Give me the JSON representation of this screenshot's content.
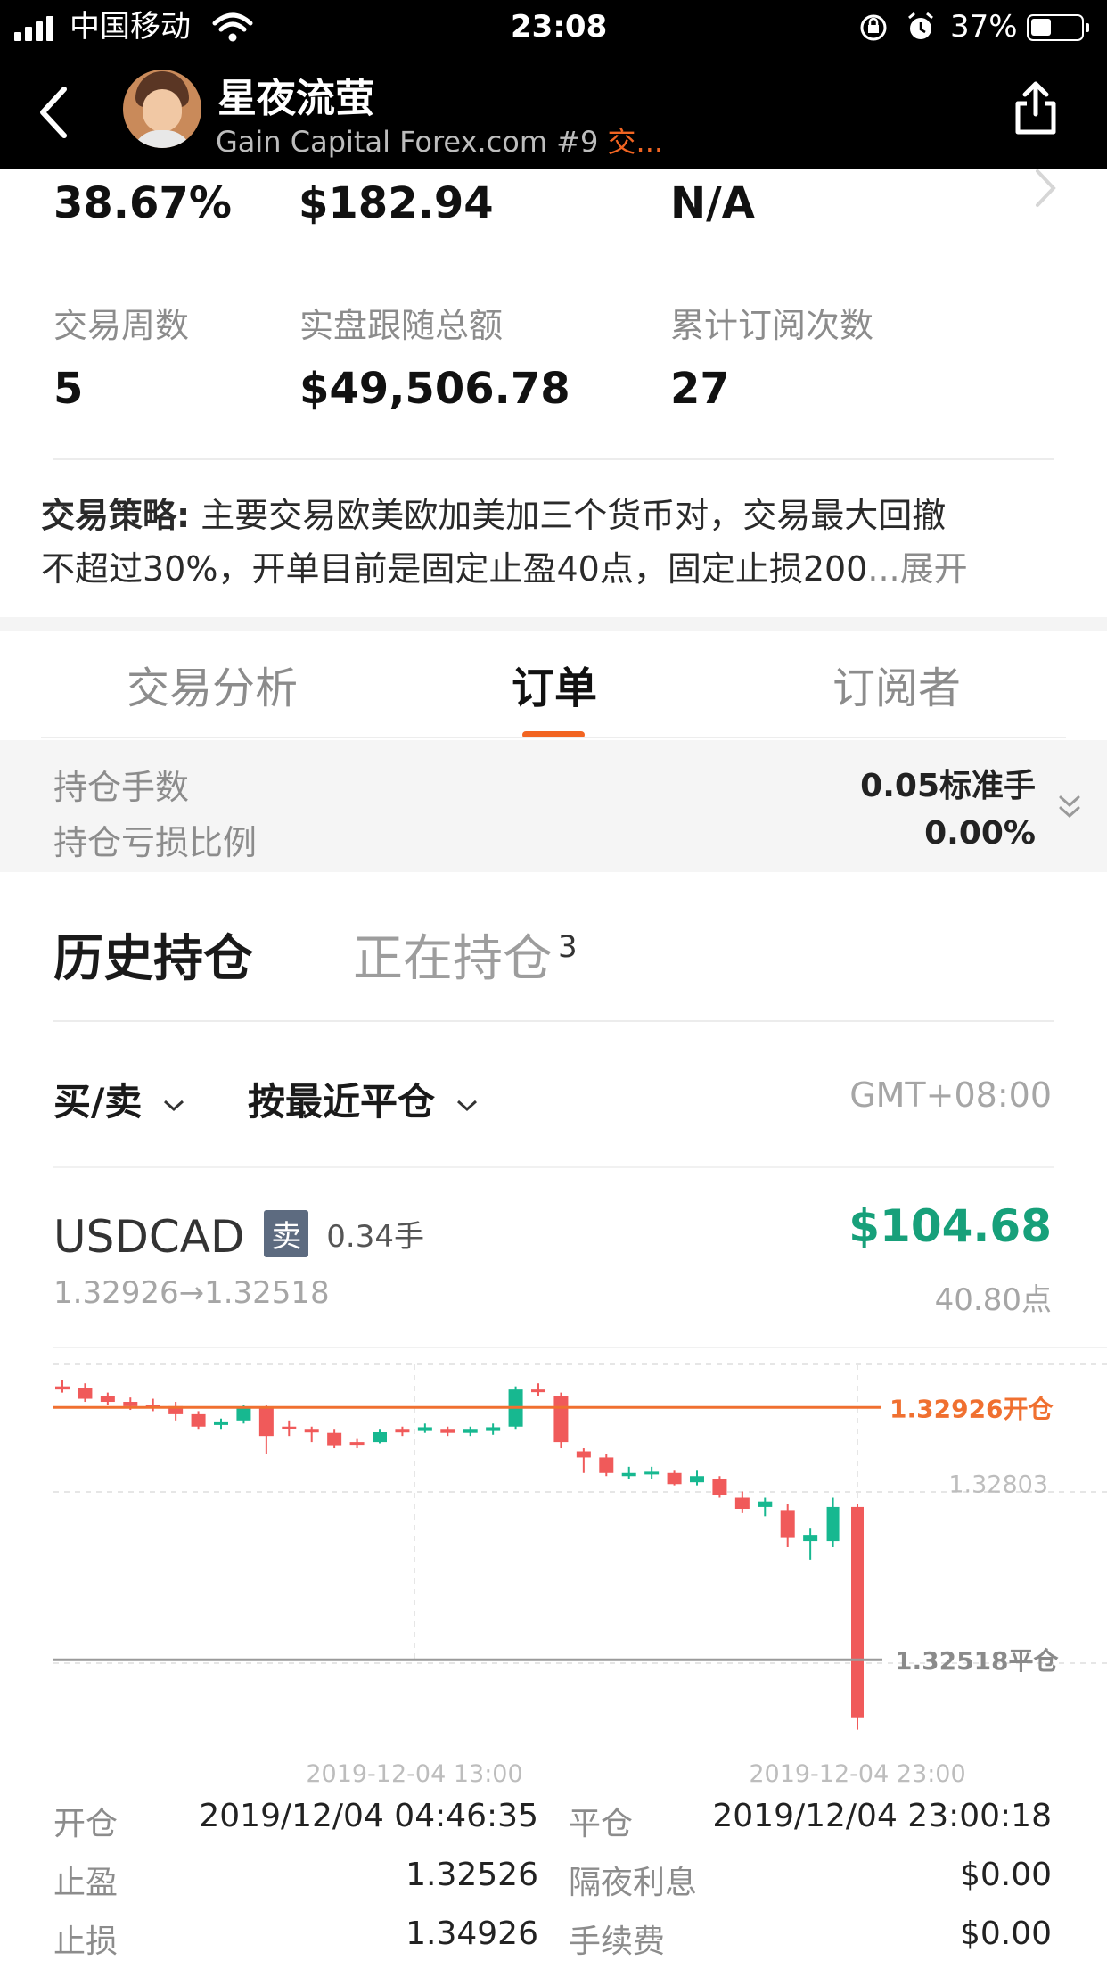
{
  "status_bar": {
    "carrier": "中国移动",
    "time": "23:08",
    "battery": "37%"
  },
  "header": {
    "name": "星夜流萤",
    "subtitle": "Gain Capital Forex.com #9",
    "subtitle_tag": "交..."
  },
  "stats_top": [
    "38.67%",
    "$182.94",
    "N/A"
  ],
  "stats_row2": {
    "labels": [
      "交易周数",
      "实盘跟随总额",
      "累计订阅次数"
    ],
    "values": [
      "5",
      "$49,506.78",
      "27"
    ]
  },
  "strategy": {
    "label": "交易策略:",
    "line1": "主要交易欧美欧加美加三个货币对，交易最大回撤",
    "line2": "不超过30%，开单目前是固定止盈40点，固定止损200",
    "ellipsis": "...",
    "expand": "展开"
  },
  "tabs": [
    "交易分析",
    "订单",
    "订阅者"
  ],
  "position_summary": {
    "lots_label": "持仓手数",
    "lots_value": "0.05标准手",
    "loss_label": "持仓亏损比例",
    "loss_value": "0.00%"
  },
  "subtabs": {
    "history": "历史持仓",
    "open": "正在持仓",
    "open_count": "3"
  },
  "filters": {
    "side": "买/卖",
    "sort": "按最近平仓",
    "timezone": "GMT+08:00"
  },
  "trade": {
    "symbol": "USDCAD",
    "side_tag": "卖",
    "lots": "0.34手",
    "profit": "$104.68",
    "price_range": "1.32926→1.32518",
    "points": "40.80点"
  },
  "chart_data": {
    "type": "candlestick",
    "open_label": "1.32926开仓",
    "mid_label": "1.32803",
    "close_label": "1.32518平仓",
    "x_ticks": [
      "2019-12-04 13:00",
      "2019-12-04 23:00"
    ],
    "colors": {
      "up": "#17b890",
      "down": "#f05a5a",
      "open_line": "#f07030",
      "close_line": "#9a9a9a"
    },
    "candles": [
      {
        "o": 1.3296,
        "c": 1.32955,
        "h": 1.3297,
        "l": 1.3295
      },
      {
        "o": 1.32958,
        "c": 1.3294,
        "h": 1.32965,
        "l": 1.32935
      },
      {
        "o": 1.32945,
        "c": 1.32935,
        "h": 1.3295,
        "l": 1.3293
      },
      {
        "o": 1.32935,
        "c": 1.32928,
        "h": 1.32942,
        "l": 1.32922
      },
      {
        "o": 1.3293,
        "c": 1.32926,
        "h": 1.3294,
        "l": 1.3292
      },
      {
        "o": 1.32928,
        "c": 1.32915,
        "h": 1.32935,
        "l": 1.32905
      },
      {
        "o": 1.32915,
        "c": 1.32895,
        "h": 1.3292,
        "l": 1.3289
      },
      {
        "o": 1.32898,
        "c": 1.32902,
        "h": 1.32908,
        "l": 1.3289
      },
      {
        "o": 1.32905,
        "c": 1.32925,
        "h": 1.3293,
        "l": 1.329
      },
      {
        "o": 1.32925,
        "c": 1.3288,
        "h": 1.3293,
        "l": 1.3285
      },
      {
        "o": 1.32895,
        "c": 1.32893,
        "h": 1.32905,
        "l": 1.3288
      },
      {
        "o": 1.3289,
        "c": 1.32888,
        "h": 1.32895,
        "l": 1.3287
      },
      {
        "o": 1.32885,
        "c": 1.32865,
        "h": 1.3289,
        "l": 1.3286
      },
      {
        "o": 1.3287,
        "c": 1.32866,
        "h": 1.32875,
        "l": 1.3286
      },
      {
        "o": 1.3287,
        "c": 1.32886,
        "h": 1.3289,
        "l": 1.32868
      },
      {
        "o": 1.3289,
        "c": 1.32888,
        "h": 1.32895,
        "l": 1.3288
      },
      {
        "o": 1.32888,
        "c": 1.32894,
        "h": 1.329,
        "l": 1.32885
      },
      {
        "o": 1.3289,
        "c": 1.32885,
        "h": 1.32895,
        "l": 1.3288
      },
      {
        "o": 1.32885,
        "c": 1.3289,
        "h": 1.32895,
        "l": 1.3288
      },
      {
        "o": 1.32888,
        "c": 1.32894,
        "h": 1.329,
        "l": 1.32882
      },
      {
        "o": 1.32895,
        "c": 1.32955,
        "h": 1.3296,
        "l": 1.3289
      },
      {
        "o": 1.32955,
        "c": 1.32952,
        "h": 1.32965,
        "l": 1.32945
      },
      {
        "o": 1.32945,
        "c": 1.3287,
        "h": 1.3295,
        "l": 1.3286
      },
      {
        "o": 1.32855,
        "c": 1.32845,
        "h": 1.3286,
        "l": 1.3282
      },
      {
        "o": 1.32845,
        "c": 1.3282,
        "h": 1.3285,
        "l": 1.32815
      },
      {
        "o": 1.32815,
        "c": 1.3282,
        "h": 1.3283,
        "l": 1.3281
      },
      {
        "o": 1.32818,
        "c": 1.32822,
        "h": 1.3283,
        "l": 1.3281
      },
      {
        "o": 1.3282,
        "c": 1.32802,
        "h": 1.32825,
        "l": 1.328
      },
      {
        "o": 1.32805,
        "c": 1.32815,
        "h": 1.32825,
        "l": 1.328
      },
      {
        "o": 1.3281,
        "c": 1.32785,
        "h": 1.32815,
        "l": 1.3278
      },
      {
        "o": 1.3278,
        "c": 1.32762,
        "h": 1.3279,
        "l": 1.32755
      },
      {
        "o": 1.32765,
        "c": 1.32774,
        "h": 1.3278,
        "l": 1.3275
      },
      {
        "o": 1.3276,
        "c": 1.32715,
        "h": 1.3277,
        "l": 1.327
      },
      {
        "o": 1.3271,
        "c": 1.3272,
        "h": 1.3273,
        "l": 1.3268
      },
      {
        "o": 1.3271,
        "c": 1.32765,
        "h": 1.3278,
        "l": 1.327
      },
      {
        "o": 1.32765,
        "c": 1.32425,
        "h": 1.3277,
        "l": 1.32405
      }
    ]
  },
  "details": {
    "open_label": "开仓",
    "open_time": "2019/12/04 04:46:35",
    "close_label": "平仓",
    "close_time": "2019/12/04 23:00:18",
    "tp_label": "止盈",
    "tp_value": "1.32526",
    "swap_label": "隔夜利息",
    "swap_value": "$0.00",
    "sl_label": "止损",
    "sl_value": "1.34926",
    "fee_label": "手续费",
    "fee_value": "$0.00"
  }
}
